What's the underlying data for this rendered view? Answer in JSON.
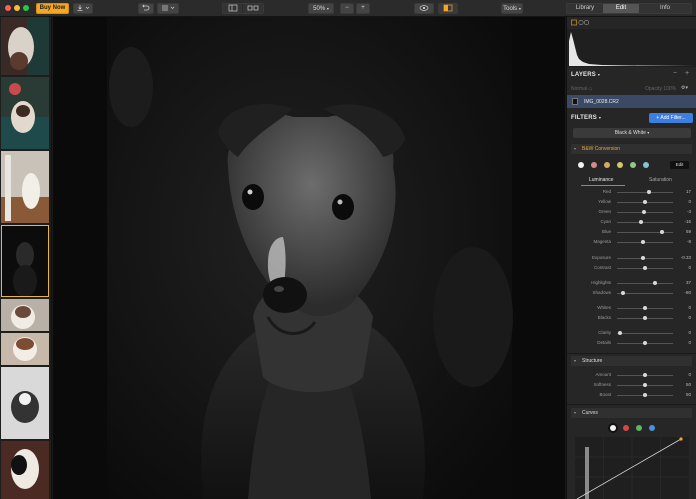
{
  "toolbar": {
    "buy_label": "Buy Now",
    "zoom_label": "50%",
    "zoom_minus": "−",
    "zoom_plus": "+",
    "tools_label": "Tools",
    "tabs": [
      {
        "label": "Library"
      },
      {
        "label": "Edit"
      },
      {
        "label": "Info"
      }
    ]
  },
  "layers": {
    "title": "LAYERS",
    "add": "+",
    "remove": "−",
    "blend": "Normal",
    "opacity": "Opacity 100%",
    "layer_name": "IMG_0028.CR2"
  },
  "filters": {
    "title": "FILTERS",
    "add_label": "+ Add Filter...",
    "preset": "Black & White",
    "bw": {
      "title": "B&W Conversion",
      "edit_label": "Edit",
      "tab_luminance": "Luminance",
      "tab_saturation": "Saturation",
      "sliders": [
        {
          "label": "Red",
          "value": "17",
          "pos": 0.58
        },
        {
          "label": "Yellow",
          "value": "0",
          "pos": 0.5
        },
        {
          "label": "Green",
          "value": "-3",
          "pos": 0.48
        },
        {
          "label": "Cyan",
          "value": "-16",
          "pos": 0.42
        },
        {
          "label": "Blue",
          "value": "59",
          "pos": 0.8
        },
        {
          "label": "Magenta",
          "value": "-8",
          "pos": 0.46
        }
      ],
      "sliders2": [
        {
          "label": "Exposure",
          "value": "-0.33",
          "pos": 0.46
        },
        {
          "label": "Contrast",
          "value": "0",
          "pos": 0.5
        }
      ],
      "sliders3": [
        {
          "label": "Highlights",
          "value": "37",
          "pos": 0.68
        },
        {
          "label": "Shadows",
          "value": "-80",
          "pos": 0.1
        }
      ],
      "sliders4": [
        {
          "label": "Whites",
          "value": "0",
          "pos": 0.5
        },
        {
          "label": "Blacks",
          "value": "0",
          "pos": 0.5
        }
      ],
      "sliders5": [
        {
          "label": "Clarity",
          "value": "0",
          "pos": 0.05
        },
        {
          "label": "Details",
          "value": "0",
          "pos": 0.5
        }
      ]
    },
    "structure": {
      "title": "Structure",
      "sliders": [
        {
          "label": "Amount",
          "value": "0",
          "pos": 0.5
        },
        {
          "label": "Softness",
          "value": "50",
          "pos": 0.5
        },
        {
          "label": "Boost",
          "value": "50",
          "pos": 0.5
        }
      ]
    },
    "curves": {
      "title": "Curves"
    }
  },
  "colors": {
    "accent": "#3d7fe0",
    "buy": "#f5a623",
    "selection": "#e8b44d"
  }
}
